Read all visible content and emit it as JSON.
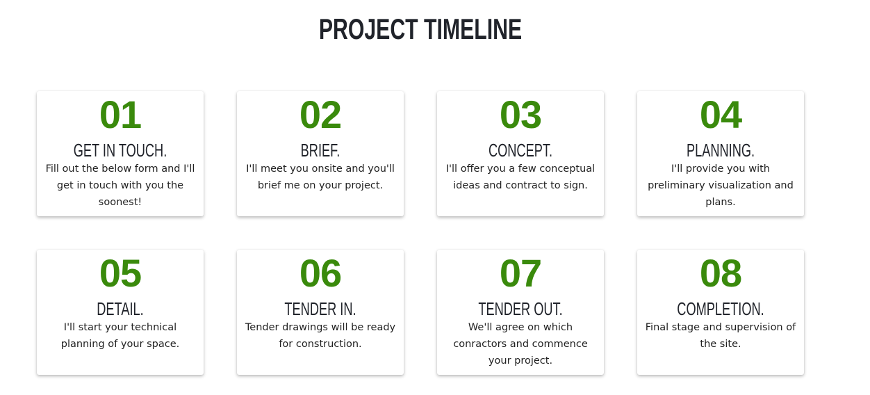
{
  "title": "PROJECT TIMELINE",
  "accent_color": "#3a8a0c",
  "steps": [
    {
      "number": "01",
      "heading": "GET IN TOUCH.",
      "text": "Fill out the below form and I'll get in touch with you the soonest!"
    },
    {
      "number": "02",
      "heading": "BRIEF.",
      "text": "I'll meet you onsite and you'll brief me on your project."
    },
    {
      "number": "03",
      "heading": "CONCEPT.",
      "text": "I'll offer you a few conceptual ideas and contract to sign."
    },
    {
      "number": "04",
      "heading": "PLANNING.",
      "text": "I'll provide you with preliminary visualization and plans."
    },
    {
      "number": "05",
      "heading": "DETAIL.",
      "text": "I'll start your technical planning of your space."
    },
    {
      "number": "06",
      "heading": "TENDER IN.",
      "text": "Tender drawings will be ready for construction."
    },
    {
      "number": "07",
      "heading": "TENDER OUT.",
      "text": "We'll agree on which conractors and commence your project."
    },
    {
      "number": "08",
      "heading": "COMPLETION.",
      "text": "Final stage and supervision of the site."
    }
  ]
}
